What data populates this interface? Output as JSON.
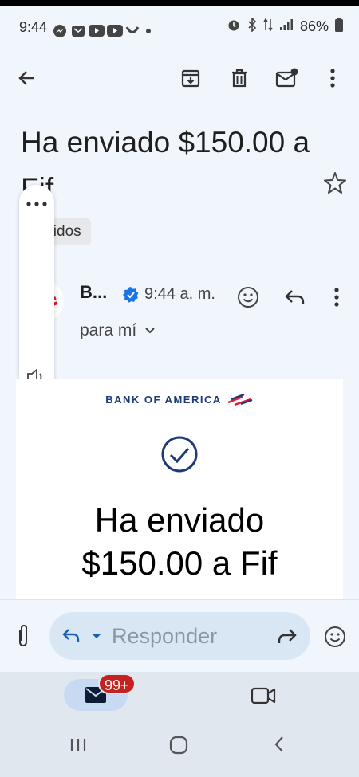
{
  "status": {
    "time": "9:44",
    "battery": "86%"
  },
  "email": {
    "subject": "Ha enviado $150.00 a Fif",
    "label": "ibidos",
    "sender": "B...",
    "time": "9:44 a. m.",
    "recipient": "para mí",
    "card": {
      "brand": "BANK OF AMERICA",
      "headline_line1": "Ha enviado",
      "headline_line2": "$150.00 a Fif"
    }
  },
  "reply": {
    "placeholder": "Responder"
  },
  "nav": {
    "mail_badge": "99+"
  },
  "colors": {
    "background": "#f1f6fd",
    "accent": "#1a73e8",
    "brand_navy": "#1d3a78",
    "brand_red": "#e31837",
    "badge": "#c5221f"
  }
}
